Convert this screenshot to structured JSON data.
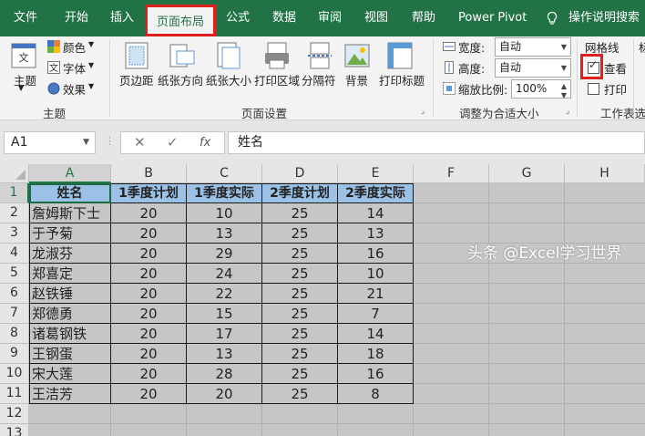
{
  "menu": {
    "tabs": [
      "文件",
      "开始",
      "插入",
      "页面布局",
      "公式",
      "数据",
      "审阅",
      "视图",
      "帮助",
      "Power Pivot"
    ],
    "active_tab": "页面布局",
    "tell_me": "操作说明搜索"
  },
  "ribbon": {
    "theme_group": {
      "themes_label": "主题",
      "colors_label": "颜色",
      "fonts_label": "字体",
      "effects_label": "效果",
      "group_label": "主题"
    },
    "page_setup": {
      "margins": "页边距",
      "orientation": "纸张方向",
      "size": "纸张大小",
      "print_area": "打印区域",
      "breaks": "分隔符",
      "background": "背景",
      "print_titles": "打印标题",
      "group_label": "页面设置"
    },
    "scale_to_fit": {
      "width_label": "宽度:",
      "width_value": "自动",
      "height_label": "高度:",
      "height_value": "自动",
      "scale_label": "缩放比例:",
      "scale_value": "100%",
      "group_label": "调整为合适大小"
    },
    "sheet_options": {
      "gridlines_label": "网格线",
      "view_label": "查看",
      "view_checked": true,
      "print_label": "打印",
      "print_checked": false,
      "headings_partial": "标",
      "group_label": "工作表选"
    }
  },
  "formula_bar": {
    "name_box": "A1",
    "fx": "fx",
    "content": "姓名"
  },
  "columns": [
    "A",
    "B",
    "C",
    "D",
    "E",
    "F",
    "G",
    "H"
  ],
  "rows": [
    "1",
    "2",
    "3",
    "4",
    "5",
    "6",
    "7",
    "8",
    "9",
    "10",
    "11",
    "12",
    "13"
  ],
  "table": {
    "headers": [
      "姓名",
      "1季度计划",
      "1季度实际",
      "2季度计划",
      "2季度实际"
    ],
    "rows": [
      [
        "詹姆斯下士",
        "20",
        "10",
        "25",
        "14"
      ],
      [
        "于予菊",
        "20",
        "13",
        "25",
        "13"
      ],
      [
        "龙淑芬",
        "20",
        "29",
        "25",
        "16"
      ],
      [
        "郑喜定",
        "20",
        "24",
        "25",
        "10"
      ],
      [
        "赵铁锤",
        "20",
        "22",
        "25",
        "21"
      ],
      [
        "郑德勇",
        "20",
        "15",
        "25",
        "7"
      ],
      [
        "诸葛钢铁",
        "20",
        "17",
        "25",
        "14"
      ],
      [
        "王钢蛋",
        "20",
        "13",
        "25",
        "18"
      ],
      [
        "宋大莲",
        "20",
        "28",
        "25",
        "16"
      ],
      [
        "王洁芳",
        "20",
        "20",
        "25",
        "8"
      ]
    ]
  },
  "colors": {
    "excel_green": "#217346",
    "header_fill": "#9bc2e6",
    "cell_fill": "#c6c6c6",
    "highlight_red": "#e0201e"
  },
  "watermark": "头条 @Excel学习世界"
}
